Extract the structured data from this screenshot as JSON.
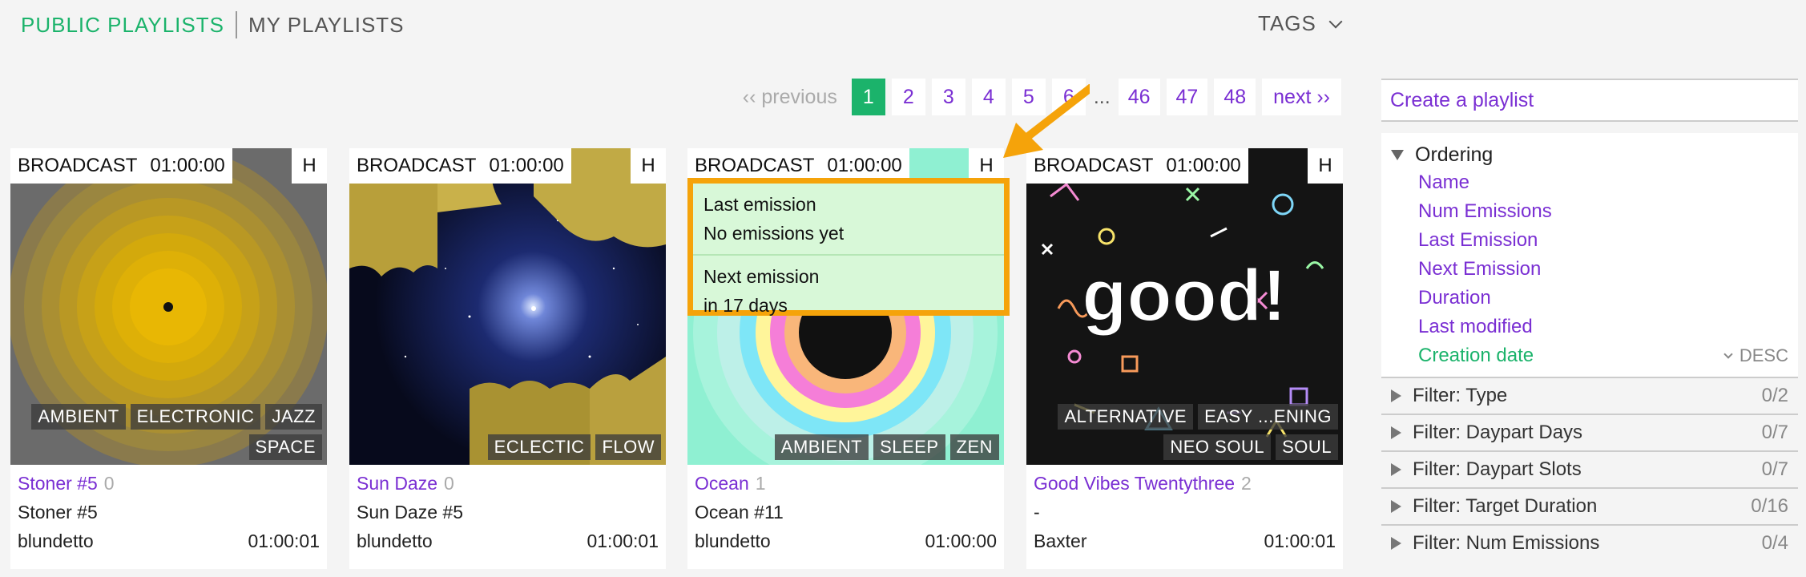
{
  "nav": {
    "public": "PUBLIC PLAYLISTS",
    "mine": "MY PLAYLISTS",
    "tags": "TAGS"
  },
  "pagination": {
    "previous": "‹‹ previous",
    "pages": [
      "1",
      "2",
      "3",
      "4",
      "5",
      "6"
    ],
    "ellipsis": "...",
    "tail_pages": [
      "46",
      "47",
      "48"
    ],
    "next": "next ››",
    "active": "1"
  },
  "cards": [
    {
      "type": "BROADCAST",
      "duration": "01:00:00",
      "h": "H",
      "tags": [
        "AMBIENT",
        "ELECTRONIC",
        "JAZZ",
        "SPACE"
      ],
      "title": "Stoner #5",
      "count": "0",
      "subtitle": "Stoner #5",
      "author": "blundetto",
      "length": "01:00:01"
    },
    {
      "type": "BROADCAST",
      "duration": "01:00:00",
      "h": "H",
      "tags": [
        "ECLECTIC",
        "FLOW"
      ],
      "title": "Sun Daze",
      "count": "0",
      "subtitle": "Sun Daze #5",
      "author": "blundetto",
      "length": "01:00:01"
    },
    {
      "type": "BROADCAST",
      "duration": "01:00:00",
      "h": "H",
      "tags": [
        "AMBIENT",
        "SLEEP",
        "ZEN"
      ],
      "title": "Ocean",
      "count": "1",
      "subtitle": "Ocean #11",
      "author": "blundetto",
      "length": "01:00:00"
    },
    {
      "type": "BROADCAST",
      "duration": "01:00:00",
      "h": "H",
      "tags": [
        "ALTERNATIVE",
        "EASY ...ENING",
        "NEO SOUL",
        "SOUL"
      ],
      "title": "Good Vibes Twentythree",
      "count": "2",
      "subtitle": "-",
      "author": "Baxter",
      "length": "01:00:01",
      "art_text": "good!"
    }
  ],
  "tooltip": {
    "last_label": "Last emission",
    "last_value": "No emissions yet",
    "next_label": "Next emission",
    "next_value": "in 17 days"
  },
  "sidebar": {
    "create": "Create a playlist",
    "ordering_title": "Ordering",
    "ordering": [
      "Name",
      "Num Emissions",
      "Last Emission",
      "Next Emission",
      "Duration",
      "Last modified",
      "Creation date"
    ],
    "active_order": "Creation date",
    "direction": "DESC",
    "filters": [
      {
        "label": "Filter: Type",
        "count": "0/2"
      },
      {
        "label": "Filter: Daypart Days",
        "count": "0/7"
      },
      {
        "label": "Filter: Daypart Slots",
        "count": "0/7"
      },
      {
        "label": "Filter: Target Duration",
        "count": "0/16"
      },
      {
        "label": "Filter: Num Emissions",
        "count": "0/4"
      }
    ]
  },
  "colors": {
    "accent_green": "#1bb36b",
    "link_purple": "#7a2fd3",
    "highlight_orange": "#f5a30a",
    "tooltip_bg": "#d8f8d8"
  }
}
